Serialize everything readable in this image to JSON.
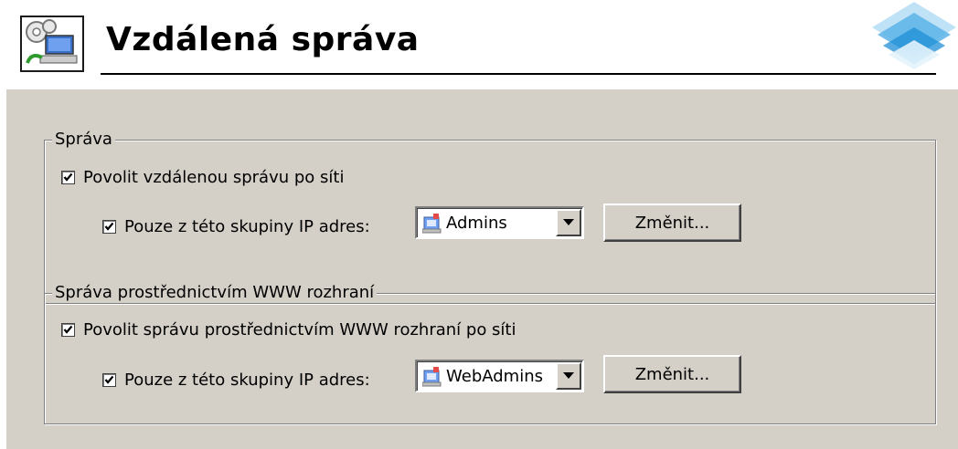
{
  "header": {
    "title": "Vzdálená správa",
    "icon": "remote-admin-icon",
    "logo": "brand-logo"
  },
  "colors": {
    "panel_bg": "#d4d0c8",
    "group_border": "#808080",
    "logo_blue": "#1f8fd6"
  },
  "groups": [
    {
      "title": "Správa",
      "main_checkbox": {
        "label": "Povolit vzdálenou správu po síti",
        "checked": true
      },
      "sub_checkbox": {
        "label": "Pouze z této skupiny IP adres:",
        "checked": true
      },
      "combo": {
        "value": "Admins",
        "icon": "ip-group-icon"
      },
      "button": "Změnit..."
    },
    {
      "title": "Správa prostřednictvím WWW rozhraní",
      "main_checkbox": {
        "label": "Povolit správu prostřednictvím WWW rozhraní po síti",
        "checked": true
      },
      "sub_checkbox": {
        "label": "Pouze z této skupiny IP adres:",
        "checked": true
      },
      "combo": {
        "value": "WebAdmins",
        "icon": "ip-group-icon"
      },
      "button": "Změnit..."
    }
  ]
}
